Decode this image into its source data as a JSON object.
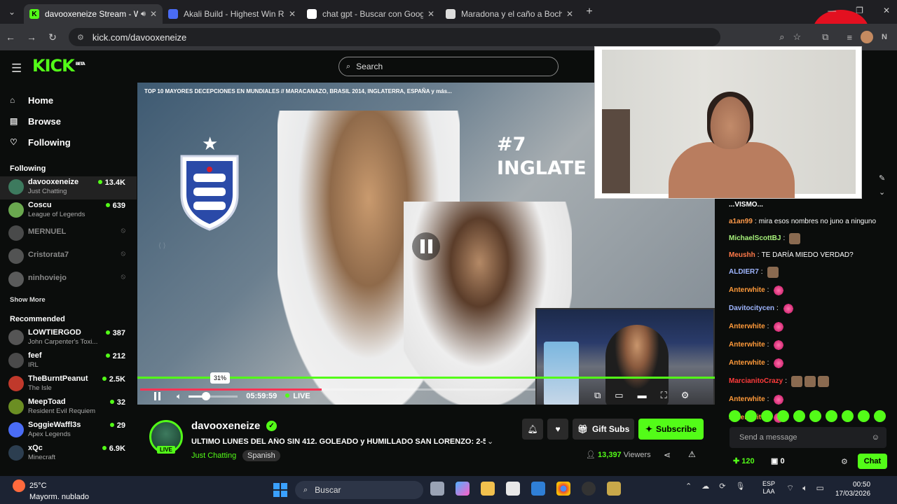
{
  "browser": {
    "tabs": [
      {
        "title": "davooxeneize Stream - Wa",
        "active": true
      },
      {
        "title": "Akali Build - Highest Win Rate",
        "active": false
      },
      {
        "title": "chat gpt - Buscar con Google",
        "active": false
      },
      {
        "title": "Maradona y el caño a Bochini",
        "active": false
      }
    ],
    "url": "kick.com/davooxeneize",
    "profile_initial": "N"
  },
  "kick": {
    "logo": "KICK",
    "logo_beta": "BETA",
    "search_placeholder": "Search",
    "nav": [
      {
        "label": "Home",
        "icon": "home-icon"
      },
      {
        "label": "Browse",
        "icon": "browse-icon"
      },
      {
        "label": "Following",
        "icon": "heart-icon"
      }
    ],
    "following_header": "Following",
    "following": [
      {
        "name": "davooxeneize",
        "category": "Just Chatting",
        "viewers": "13.4K",
        "live": true
      },
      {
        "name": "Coscu",
        "category": "League of Legends",
        "viewers": "639",
        "live": true
      },
      {
        "name": "MERNUEL",
        "category": "",
        "viewers": "",
        "live": false
      },
      {
        "name": "Cristorata7",
        "category": "",
        "viewers": "",
        "live": false
      },
      {
        "name": "ninhoviejo",
        "category": "",
        "viewers": "",
        "live": false
      }
    ],
    "show_more": "Show More",
    "recommended_header": "Recommended",
    "recommended": [
      {
        "name": "LOWTIERGOD",
        "category": "John Carpenter's Toxi...",
        "viewers": "387"
      },
      {
        "name": "feef",
        "category": "IRL",
        "viewers": "212"
      },
      {
        "name": "TheBurntPeanut",
        "category": "The Isle",
        "viewers": "2.5K"
      },
      {
        "name": "MeepToad",
        "category": "Resident Evil Requiem",
        "viewers": "32"
      },
      {
        "name": "SoggieWaffl3s",
        "category": "Apex Legends",
        "viewers": "29"
      },
      {
        "name": "xQc",
        "category": "Minecraft",
        "viewers": "6.9K"
      }
    ]
  },
  "player": {
    "video_title": "TOP 10 MAYORES DECEPCIONES EN MUNDIALES // MARACANAZO, BRASIL 2014, INGLATERRA, ESPAÑA y más...",
    "overlay_rank": "#7",
    "overlay_country": "INGLATE",
    "volume_badge": "31%",
    "volume_level": 0.31,
    "time": "05:59:59",
    "live_label": "LIVE"
  },
  "stream": {
    "streamer": "davooxeneize",
    "live_badge": "LIVE",
    "title": "ULTIMO LUNES DEL AÑO SIN 412. GOLEADO y HUMILLADO SAN LORENZO: 2-5 ...",
    "category": "Just Chatting",
    "language": "Spanish",
    "gift_subs": "Gift Subs",
    "subscribe": "Subscribe",
    "viewers": "13,397",
    "viewers_label": "Viewers"
  },
  "chat": {
    "partial_top": "...VISMO...",
    "messages": [
      {
        "user": "a1an99",
        "color": "#ff9a4a",
        "text": "mira esos nombres no juno a ninguno",
        "emotes": []
      },
      {
        "user": "MichaelScottBJ",
        "color": "#a6f07a",
        "text": "",
        "emotes": [
          "face"
        ]
      },
      {
        "user": "Meushh",
        "color": "#ff7a4a",
        "text": "TE DARÍA MIEDO VERDAD?",
        "emotes": []
      },
      {
        "user": "ALDIER7",
        "color": "#9fb6ff",
        "text": "",
        "emotes": [
          "face"
        ]
      },
      {
        "user": "Anterwhite",
        "color": "#ff9a3a",
        "text": "",
        "emotes": [
          "heart"
        ]
      },
      {
        "user": "Davitocitycen",
        "color": "#9fb6ff",
        "text": "",
        "emotes": [
          "heart"
        ]
      },
      {
        "user": "Anterwhite",
        "color": "#ff9a3a",
        "text": "",
        "emotes": [
          "heart"
        ]
      },
      {
        "user": "Anterwhite",
        "color": "#ff9a3a",
        "text": "",
        "emotes": [
          "heart"
        ]
      },
      {
        "user": "Anterwhite",
        "color": "#ff9a3a",
        "text": "",
        "emotes": [
          "heart"
        ]
      },
      {
        "user": "MarcianitoCrazy",
        "color": "#ff3b3b",
        "text": "",
        "emotes": [
          "face",
          "face",
          "face"
        ]
      },
      {
        "user": "Anterwhite",
        "color": "#ff9a3a",
        "text": "",
        "emotes": [
          "heart"
        ]
      },
      {
        "user": "Anterwhite",
        "color": "#ff9a3a",
        "text": "",
        "emotes": [
          "heart"
        ]
      }
    ],
    "input_placeholder": "Send a message",
    "points": "120",
    "drops": "0",
    "chat_button": "Chat"
  },
  "taskbar": {
    "temperature": "25°C",
    "weather": "Mayorm. nublado",
    "search": "Buscar",
    "lang_line1": "ESP",
    "lang_line2": "LAA",
    "time": "00:50",
    "date": "17/03/2026"
  },
  "colors": {
    "kick_green": "#53fc18",
    "background": "#0b0d0c"
  }
}
